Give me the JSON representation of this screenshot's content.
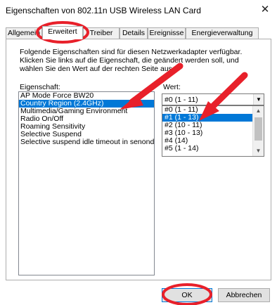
{
  "window": {
    "title": "Eigenschaften von 802.11n USB Wireless LAN Card",
    "close_glyph": "✕"
  },
  "tabs": [
    {
      "label": "Allgemein"
    },
    {
      "label": "Erweitert"
    },
    {
      "label": "Treiber"
    },
    {
      "label": "Details"
    },
    {
      "label": "Ereignisse"
    },
    {
      "label": "Energieverwaltung"
    }
  ],
  "main": {
    "description": "Folgende Eigenschaften sind für diesen Netzwerkadapter verfügbar. Klicken Sie links auf die Eigenschaft, die geändert werden soll, und wählen Sie den Wert auf der rechten Seite aus.",
    "property_label": "Eigenschaft:",
    "value_label": "Wert:",
    "properties": [
      {
        "label": "AP Mode Force BW20"
      },
      {
        "label": "Country Region (2.4GHz)"
      },
      {
        "label": "Multimedia/Gaming Environment"
      },
      {
        "label": "Radio On/Off"
      },
      {
        "label": "Roaming Sensitivity"
      },
      {
        "label": "Selective Suspend"
      },
      {
        "label": "Selective suspend idle timeout in senonds"
      }
    ],
    "selected_property_index": 1,
    "value_combo": "#0 (1 - 11)",
    "value_options": [
      {
        "label": "#0 (1 - 11)"
      },
      {
        "label": "#1 (1 - 13)"
      },
      {
        "label": "#2 (10 - 11)"
      },
      {
        "label": "#3 (10 - 13)"
      },
      {
        "label": "#4 (14)"
      },
      {
        "label": "#5 (1 - 14)"
      }
    ],
    "highlighted_option_index": 1
  },
  "footer": {
    "ok_label": "OK",
    "cancel_label": "Abbrechen"
  },
  "colors": {
    "selection": "#0078d7",
    "annotation": "#e8202a"
  },
  "icons": {
    "combo_arrow": "▼",
    "scroll_up": "▲",
    "scroll_down": "▼"
  }
}
